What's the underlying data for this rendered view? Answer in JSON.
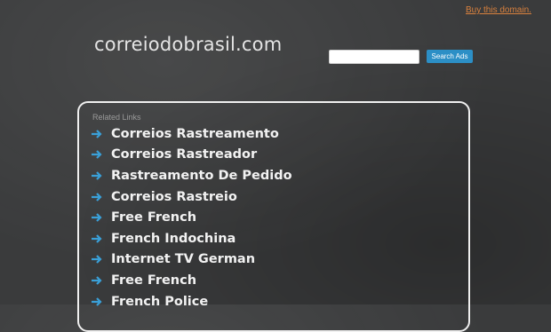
{
  "header": {
    "buy_link": "Buy this domain.",
    "site_title": "correiodobrasil.com"
  },
  "search": {
    "value": "",
    "button_label": "Search Ads"
  },
  "related_links": {
    "heading": "Related Links",
    "items": [
      "Correios Rastreamento",
      "Correios Rastreador",
      "Rastreamento De Pedido",
      "Correios Rastreio",
      "Free French",
      "French Indochina",
      "Internet TV German",
      "Free French",
      "French Police"
    ]
  },
  "colors": {
    "background": "#3a3b3c",
    "buy_link": "#d9813e",
    "search_button": "#2c8fc6",
    "arrow": "#3aa0d8",
    "link_text": "#f2f2f2"
  },
  "icons": {
    "link_bullet": "arrow-right-icon"
  }
}
